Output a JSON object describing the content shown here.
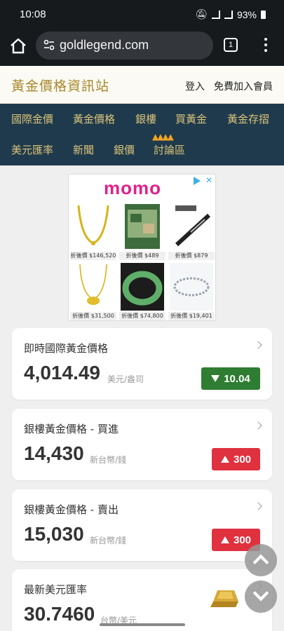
{
  "status_bar": {
    "time": "10:08",
    "battery": "93%"
  },
  "browser": {
    "url": "goldlegend.com",
    "tab_count": "1"
  },
  "site": {
    "title": "黃金價格資訊站",
    "login": "登入",
    "register": "免費加入會員"
  },
  "nav": [
    "國際金價",
    "黃金價格",
    "銀樓",
    "買黃金",
    "黃金存摺",
    "美元匯率",
    "新聞",
    "銀價",
    "討論區"
  ],
  "ad": {
    "brand": "momo",
    "items": [
      {
        "price": "折後價 $146,520",
        "icon": "gold-necklace"
      },
      {
        "price": "折後價 $489",
        "icon": "book"
      },
      {
        "price": "折後價 $879",
        "icon": "pen"
      },
      {
        "price": "折後價 $31,500",
        "icon": "gold-pendant-necklace"
      },
      {
        "price": "折後價 $74,800",
        "icon": "jade-bangle"
      },
      {
        "price": "折後價 $19,401",
        "icon": "silver-bracelet"
      }
    ]
  },
  "cards": [
    {
      "title": "即時國際黃金價格",
      "value": "4,014.49",
      "unit": "美元/盎司",
      "change": "10.04",
      "direction": "down"
    },
    {
      "title": "銀樓黃金價格 - 買進",
      "value": "14,430",
      "unit": "新台幣/錢",
      "change": "300",
      "direction": "up"
    },
    {
      "title": "銀樓黃金價格 - 賣出",
      "value": "15,030",
      "unit": "新台幣/錢",
      "change": "300",
      "direction": "up"
    },
    {
      "title": "最新美元匯率",
      "value": "30.7460",
      "unit": "台幣/美元"
    }
  ],
  "colors": {
    "down": "#2e7d32",
    "up": "#e0313f",
    "nav_bg": "#1f3a4c",
    "gold": "#a8872a"
  }
}
